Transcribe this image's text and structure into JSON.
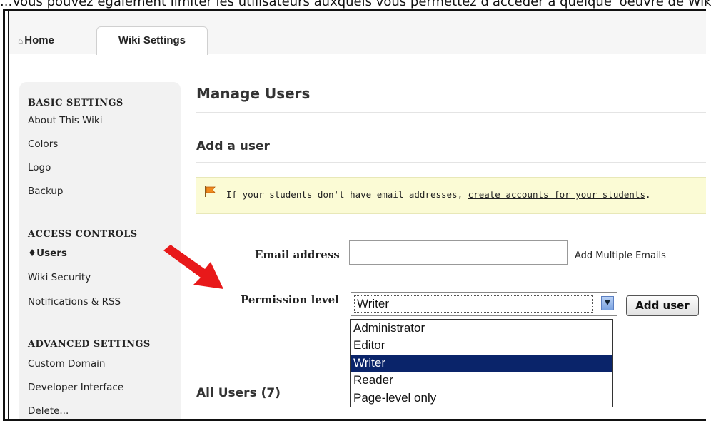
{
  "caption": "...Vous pouvez également limiter les utilisateurs auxquels vous permettez d'accéder à quelque 'oeuvre de Wiki.",
  "tabs": {
    "home_label": "Home",
    "active_label": "Wiki Settings"
  },
  "sidebar": {
    "basic": {
      "heading": "BASIC SETTINGS",
      "items": [
        {
          "label": "About This Wiki"
        },
        {
          "label": "Colors"
        },
        {
          "label": "Logo"
        },
        {
          "label": "Backup"
        }
      ]
    },
    "access": {
      "heading": "ACCESS CONTROLS",
      "items": [
        {
          "label": "Users",
          "current": true
        },
        {
          "label": "Wiki Security"
        },
        {
          "label": "Notifications & RSS"
        }
      ]
    },
    "advanced": {
      "heading": "ADVANCED SETTINGS",
      "items": [
        {
          "label": "Custom Domain"
        },
        {
          "label": "Developer Interface"
        },
        {
          "label": "Delete..."
        }
      ]
    }
  },
  "main": {
    "title": "Manage Users",
    "add_heading": "Add a user",
    "notice": {
      "text_before": "If your students don't have email addresses, ",
      "link": "create accounts for your students",
      "text_after": "."
    },
    "email_label": "Email address",
    "email_value": "",
    "add_multiple_label": "Add Multiple Emails",
    "permission_label": "Permission level",
    "permission_selected": "Writer",
    "permission_options": [
      "Administrator",
      "Editor",
      "Writer",
      "Reader",
      "Page-level only"
    ],
    "add_user_button": "Add user",
    "all_users_heading": "All Users (7)"
  },
  "colors": {
    "highlight": "#0a246a",
    "notice_bg": "#fbfbd5",
    "arrow": "#e8191a"
  },
  "icons": [
    "house-icon",
    "flag-icon",
    "dropdown-arrow-icon",
    "red-arrow-icon"
  ]
}
